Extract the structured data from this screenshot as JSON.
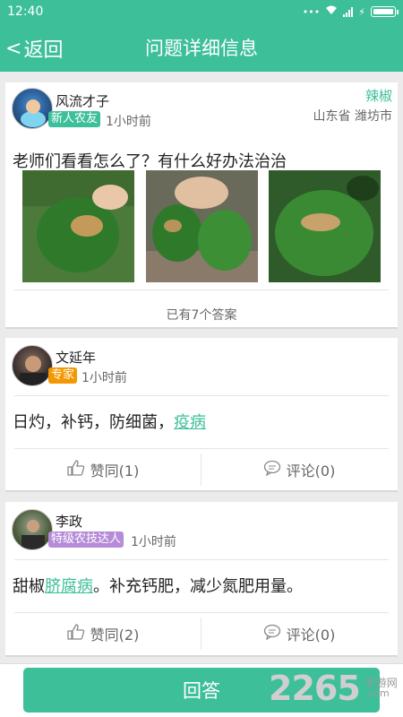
{
  "status": {
    "time": "12:40"
  },
  "header": {
    "back_label": "返回",
    "title": "问题详细信息"
  },
  "question": {
    "username": "风流才子",
    "badge": "新人农友",
    "time": "1小时前",
    "crop": "辣椒",
    "location": "山东省 潍坊市",
    "text": "老师们看看怎么了？有什么好办法治治",
    "answers_count": "已有7个答案"
  },
  "answers": [
    {
      "username": "文延年",
      "badge": "专家",
      "badge_color": "#f39800",
      "time": "1小时前",
      "text_plain": "日灼，补钙，防细菌，",
      "text_link": "疫病",
      "text_tail": "",
      "like_label": "赞同(1)",
      "comment_label": "评论(0)"
    },
    {
      "username": "李政",
      "badge": "特级农技达人",
      "badge_color": "#b68bd8",
      "time": "1小时前",
      "text_plain": "甜椒",
      "text_link": "脐腐病",
      "text_tail": "。补充钙肥，减少氮肥用量。",
      "like_label": "赞同(2)",
      "comment_label": "评论(0)"
    }
  ],
  "footer": {
    "answer_button": "回答"
  },
  "watermark": {
    "number": "2265",
    "cn": "手游网",
    "domain": ".com"
  },
  "colors": {
    "accent": "#3dbf9a",
    "newbie_badge": "#3dbf9a",
    "expert_badge": "#f39800",
    "master_badge": "#b68bd8"
  }
}
